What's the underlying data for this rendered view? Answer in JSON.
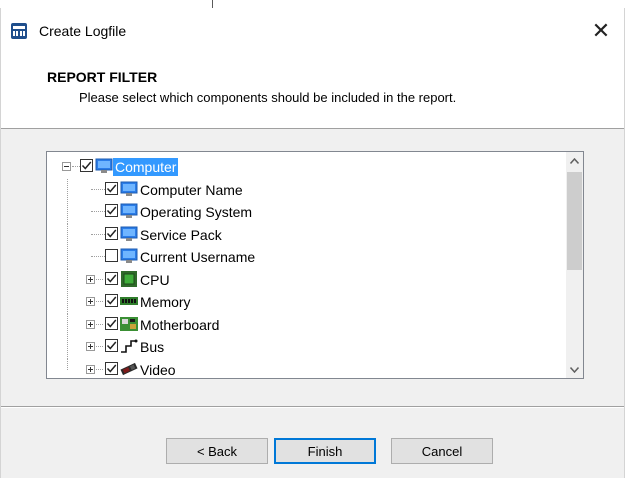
{
  "window": {
    "title": "Create Logfile",
    "close_glyph": "✕"
  },
  "header": {
    "title": "REPORT FILTER",
    "subtitle": "Please select which components should be included in the report."
  },
  "tree": {
    "items": [
      {
        "label": "Computer",
        "checked": true,
        "level": 0,
        "expander": "minus",
        "icon": "computer-icon",
        "selected": true
      },
      {
        "label": "Computer Name",
        "checked": true,
        "level": 1,
        "expander": "none",
        "icon": "computer-icon"
      },
      {
        "label": "Operating System",
        "checked": true,
        "level": 1,
        "expander": "none",
        "icon": "computer-icon"
      },
      {
        "label": "Service Pack",
        "checked": true,
        "level": 1,
        "expander": "none",
        "icon": "computer-icon"
      },
      {
        "label": "Current Username",
        "checked": false,
        "level": 1,
        "expander": "none",
        "icon": "computer-icon"
      },
      {
        "label": "CPU",
        "checked": true,
        "level": 1,
        "expander": "plus",
        "icon": "cpu-icon"
      },
      {
        "label": "Memory",
        "checked": true,
        "level": 1,
        "expander": "plus",
        "icon": "memory-icon"
      },
      {
        "label": "Motherboard",
        "checked": true,
        "level": 1,
        "expander": "plus",
        "icon": "motherboard-icon"
      },
      {
        "label": "Bus",
        "checked": true,
        "level": 1,
        "expander": "plus",
        "icon": "bus-icon"
      },
      {
        "label": "Video",
        "checked": true,
        "level": 1,
        "expander": "plus",
        "icon": "video-card-icon"
      }
    ]
  },
  "buttons": {
    "back": "< Back",
    "finish": "Finish",
    "cancel": "Cancel"
  },
  "colors": {
    "selection": "#3399ff",
    "default_button_border": "#0078d7"
  }
}
